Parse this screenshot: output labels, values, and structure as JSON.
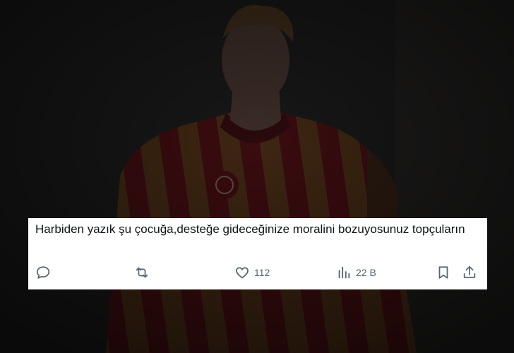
{
  "tweet": {
    "text": "Harbiden yazık şu çocuğa,desteğe gideceğinize moralini bozuyosunuz topçuların",
    "actions": {
      "reply": {
        "icon": "reply-icon",
        "count": ""
      },
      "retweet": {
        "icon": "retweet-icon",
        "count": ""
      },
      "like": {
        "icon": "heart-icon",
        "count": "112"
      },
      "views": {
        "icon": "analytics-icon",
        "count": "22 B"
      },
      "bookmark": {
        "icon": "bookmark-icon"
      },
      "share": {
        "icon": "share-icon"
      }
    }
  },
  "colors": {
    "card_background": "#ffffff",
    "text": "#0f1419",
    "icon": "#536471",
    "jersey_red": "#8a1c1f",
    "jersey_yellow": "#c7932d"
  }
}
